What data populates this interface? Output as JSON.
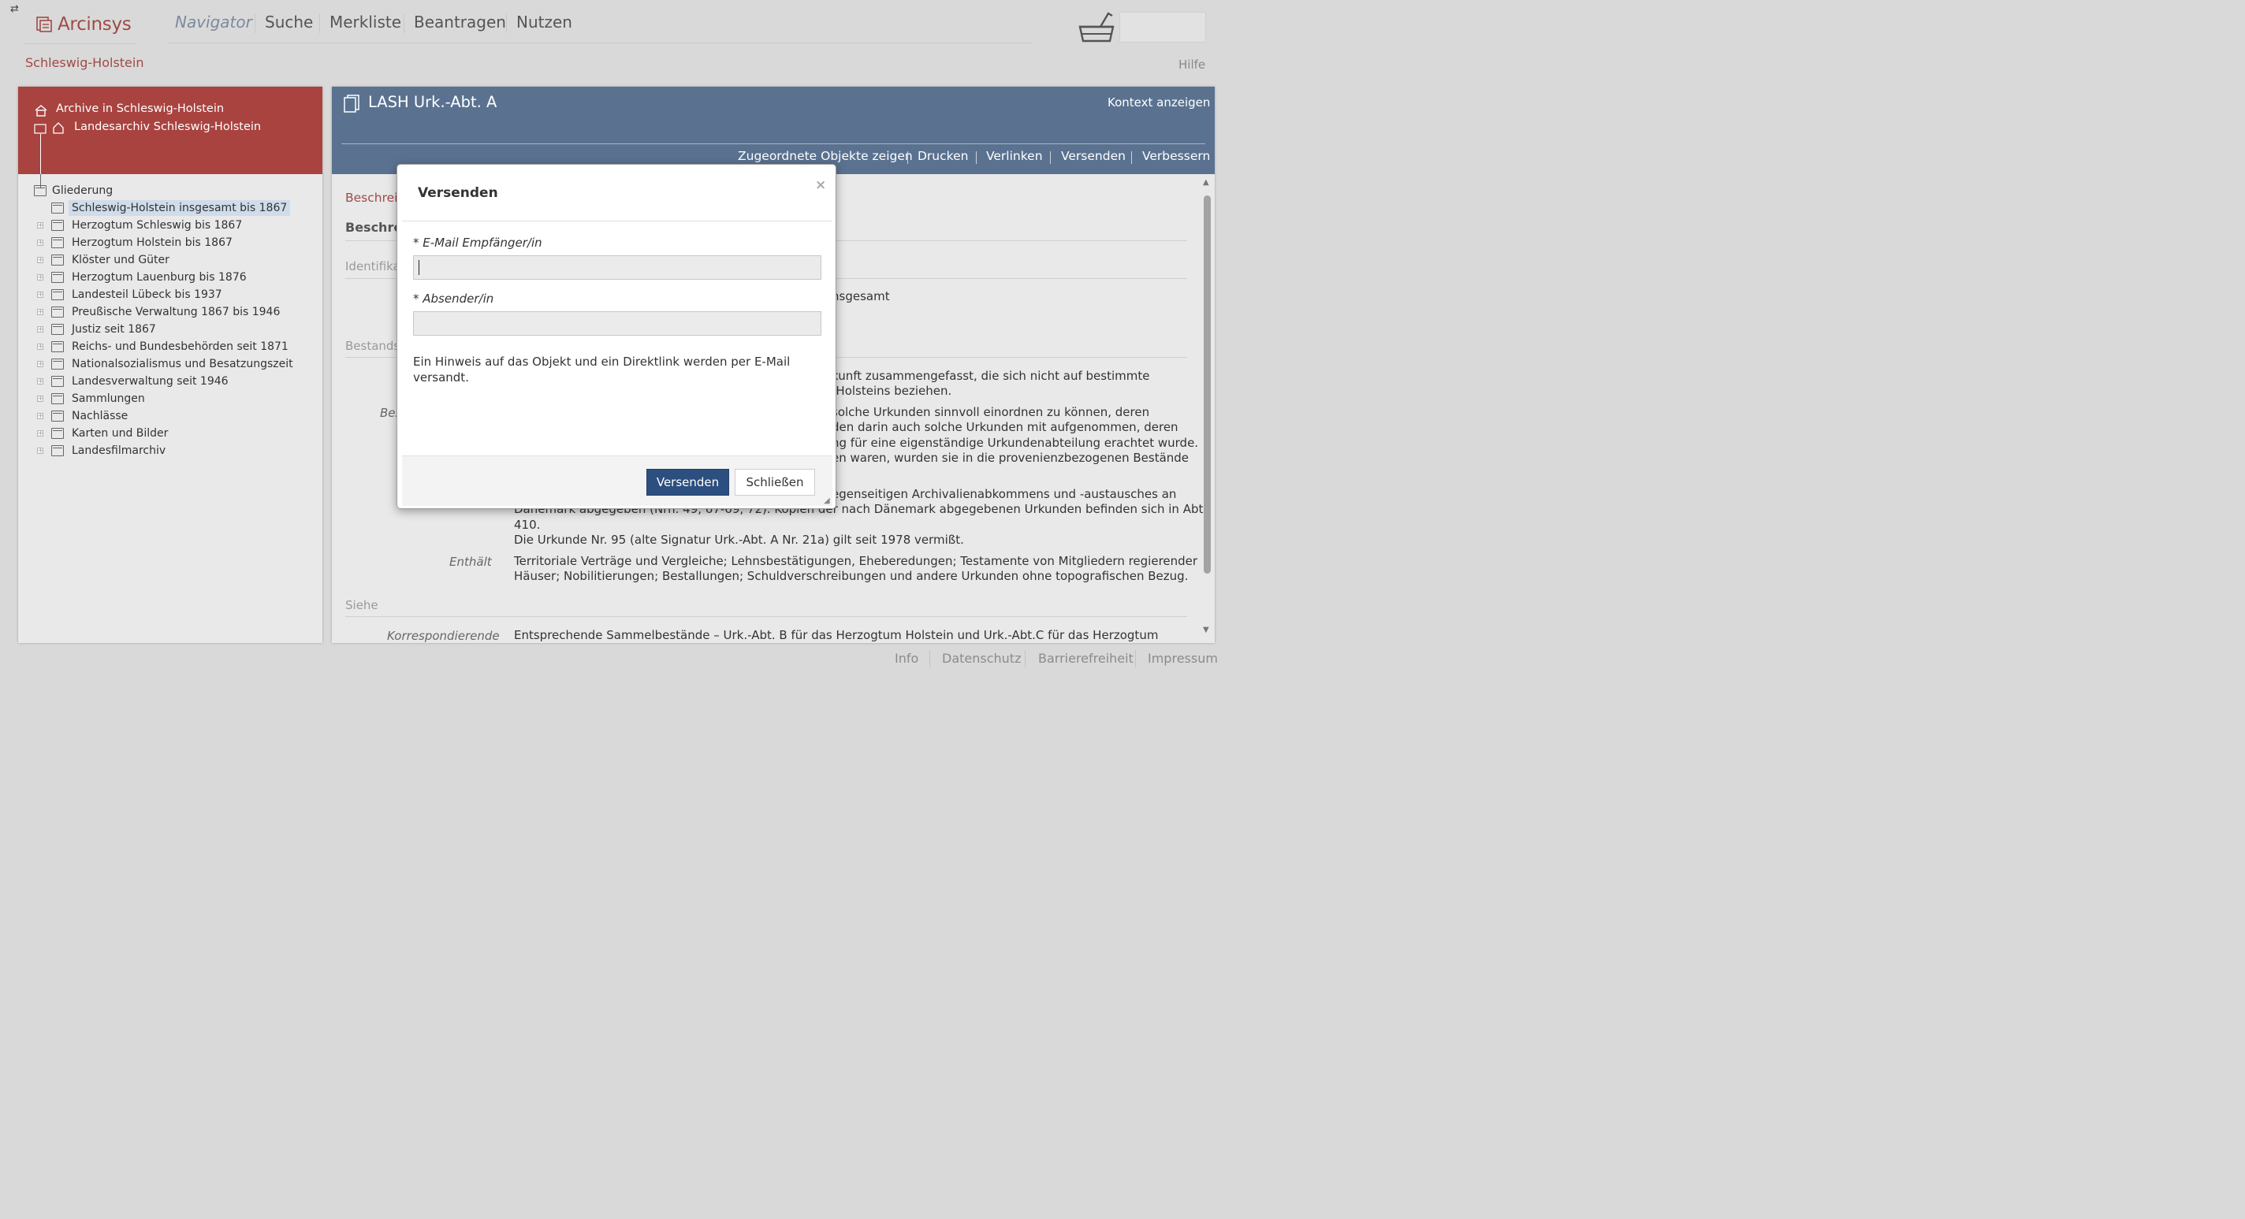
{
  "header": {
    "logo_text": "Arcinsys",
    "nav": [
      "Navigator",
      "Suche",
      "Merkliste",
      "Beantragen",
      "Nutzen"
    ],
    "region": "Schleswig-Holstein",
    "help": "Hilfe"
  },
  "left_panel": {
    "breadcrumb_archives": "Archive in Schleswig-Holstein",
    "breadcrumb_archive": "Landesarchiv Schleswig-Holstein",
    "tree_root": "Gliederung",
    "tree_items": [
      "Schleswig-Holstein insgesamt bis 1867",
      "Herzogtum Schleswig bis 1867",
      "Herzogtum Holstein bis 1867",
      "Klöster und Güter",
      "Herzogtum Lauenburg bis 1876",
      "Landesteil Lübeck bis 1937",
      "Preußische Verwaltung 1867 bis 1946",
      "Justiz seit 1867",
      "Reichs- und Bundesbehörden seit 1871",
      "Nationalsozialismus und Besatzungszeit",
      "Landesverwaltung seit 1946",
      "Sammlungen",
      "Nachlässe",
      "Karten und Bilder",
      "Landesfilmarchiv"
    ]
  },
  "record": {
    "title": "LASH Urk.-Abt. A",
    "context": "Kontext anzeigen",
    "actions": [
      "Zugeordnete Objekte zeigen",
      "Drucken",
      "Verlinken",
      "Versenden",
      "Verbessern"
    ],
    "section_red": "Beschrei",
    "section_bold": "Beschrei",
    "identifikation": "Identifika",
    "identifikation_value": "nsgesamt",
    "bestands": "Bestands",
    "bes_label": "Bes",
    "para1_line1": "kunft zusammengefasst, die sich nicht auf bestimmte",
    "para1_line2": "-Holsteins beziehen.",
    "para2_line1": "solche Urkunden sinnvoll einordnen zu können, deren",
    "para2_line2": "den darin auch solche Urkunden mit aufgenommen, deren",
    "para2_line3": "ng für eine eigenständige Urkundenabteilung erachtet wurde.",
    "para2_line4": "en waren, wurden sie in die provenienzbezogenen Bestände",
    "para3_line1": "egenseitigen Archivalienabkommens und -austausches an",
    "para3_line2": "Dänemark abgegeben (Nrn. 49, 67-69, 72). Kopien der nach Dänemark abgegebenen Urkunden befinden sich in Abt.",
    "para3_line3": "410.",
    "para3_line4": "Die Urkunde Nr. 95 (alte Signatur Urk.-Abt. A Nr. 21a) gilt seit 1978 vermißt.",
    "enthaelt_label": "Enthält",
    "enthaelt_line1": "Territoriale Verträge und Vergleiche; Lehnsbestätigungen, Eheberedungen; Testamente von Mitgliedern regierender",
    "enthaelt_line2": "Häuser; Nobilitierungen; Bestallungen; Schuldverschreibungen und andere Urkunden ohne topografischen Bezug.",
    "siehe": "Siehe",
    "korr_label": "Korrespondierende",
    "korr_text": "Entsprechende Sammelbestände – Urk.-Abt. B für das Herzogtum Holstein und Urk.-Abt.C für das Herzogtum Schleswig"
  },
  "footer": [
    "Info",
    "Datenschutz",
    "Barrierefreiheit",
    "Impressum"
  ],
  "modal": {
    "title": "Versenden",
    "close": "×",
    "email_label": "* E-Mail Empfänger/in",
    "email_value": "",
    "sender_label": "* Absender/in",
    "sender_value": "",
    "hint": "Ein Hinweis auf das Objekt und ein Direktlink werden per E-Mail versandt.",
    "send_button": "Versenden",
    "close_button": "Schließen"
  },
  "colors": {
    "archive_header": "#a9433f",
    "record_header": "#5a7290",
    "primary_button": "#2c4f80",
    "brand_text": "#a04a46"
  }
}
